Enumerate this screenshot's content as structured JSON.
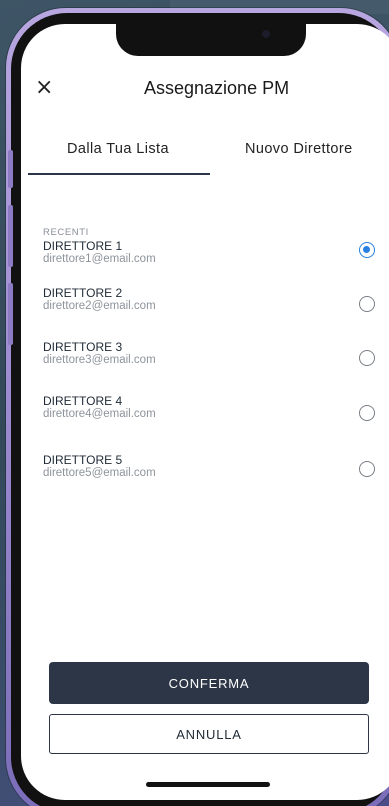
{
  "header": {
    "title": "Assegnazione PM",
    "close_glyph": "×"
  },
  "tabs": [
    {
      "label": "Dalla Tua Lista",
      "selected": true
    },
    {
      "label": "Nuovo Direttore",
      "selected": false
    }
  ],
  "section": {
    "label": "RECENTI"
  },
  "directors": [
    {
      "name": "DIRETTORE 1",
      "email": "direttore1@email.com",
      "selected": true
    },
    {
      "name": "DIRETTORE 2",
      "email": "direttore2@email.com",
      "selected": false
    },
    {
      "name": "DIRETTORE 3",
      "email": "direttore3@email.com",
      "selected": false
    },
    {
      "name": "DIRETTORE 4",
      "email": "direttore4@email.com",
      "selected": false
    },
    {
      "name": "DIRETTORE 5",
      "email": "direttore5@email.com",
      "selected": false
    }
  ],
  "actions": {
    "confirm_label": "CONFERMA",
    "cancel_label": "ANNULLA"
  },
  "colors": {
    "primary": "#2c3647",
    "radio_selected": "#2a7fe0"
  }
}
